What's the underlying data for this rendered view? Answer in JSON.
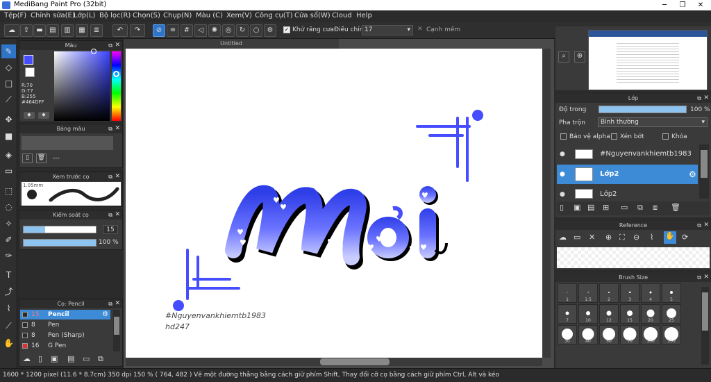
{
  "window": {
    "title": "MediBang Paint Pro (32bit)",
    "min": "─",
    "max": "❐",
    "close": "✕"
  },
  "menu": [
    "Tệp(F)",
    "Chỉnh sửa(E)",
    "Lớp(L)",
    "Bộ lọc(R)",
    "Chọn(S)",
    "Chụp(N)",
    "Màu (C)",
    "Xem(V)",
    "Công cụ(T)",
    "Cửa sổ(W)",
    "Cloud",
    "Help"
  ],
  "toolbar": {
    "antialias_label": "Khử răng cưa",
    "adjust_label": "Điều chỉnh",
    "adjust_value": "17",
    "edge_label": "Cạnh mềm"
  },
  "color_panel": {
    "title": "Màu",
    "r": "R:70",
    "g": "G:77",
    "b": "B:255",
    "hex": "#464DFF",
    "fg_color": "#464DFF"
  },
  "palette_panel": {
    "title": "Bảng màu",
    "item": "---"
  },
  "brush_preview": {
    "title": "Xem trước cọ",
    "size": "1.05mm"
  },
  "brush_control": {
    "title": "Kiểm soát cọ",
    "size_value": "15",
    "opacity_value": "100 %"
  },
  "brush_list": {
    "title": "Cọ: Pencil",
    "items": [
      {
        "size": "15",
        "name": "Pencil",
        "color": "#2b2b2b"
      },
      {
        "size": "8",
        "name": "Pen",
        "color": "#2b2b2b"
      },
      {
        "size": "8",
        "name": "Pen (Sharp)",
        "color": "#2b2b2b"
      },
      {
        "size": "16",
        "name": "G Pen",
        "color": "#e03030"
      }
    ]
  },
  "canvas": {
    "tab_title": "Untitled",
    "main_text": "Mới",
    "watermark_line1": "#Nguyenvankhiemtb1983",
    "watermark_line2": "hd247"
  },
  "layer_panel": {
    "title": "Lớp",
    "opacity_label": "Độ trong",
    "opacity_value": "100 %",
    "blend_label": "Pha trộn",
    "blend_value": "Bình thường",
    "protect_alpha": "Bảo vệ alpha",
    "clip": "Xén bớt",
    "lock": "Khóa",
    "layers": [
      "#Nguyenvankhiemtb1983",
      "Lớp2",
      "Lớp2"
    ]
  },
  "reference_panel": {
    "title": "Reference"
  },
  "brush_size_panel": {
    "title": "Brush Size",
    "sizes": [
      "1",
      "1.5",
      "2",
      "3",
      "4",
      "5",
      "7",
      "10",
      "12",
      "15",
      "20",
      "25",
      "30",
      "40",
      "50",
      "70",
      "100",
      "150"
    ]
  },
  "status": {
    "text": "1600 * 1200 pixel   (11.6 * 8.7cm)   350 dpi   150 %   ( 764, 482 )   Vẽ một đường thẳng bằng cách giữ phím Shift, Thay đổi cỡ cọ bằng cách giữ phím Ctrl, Alt và kéo"
  }
}
